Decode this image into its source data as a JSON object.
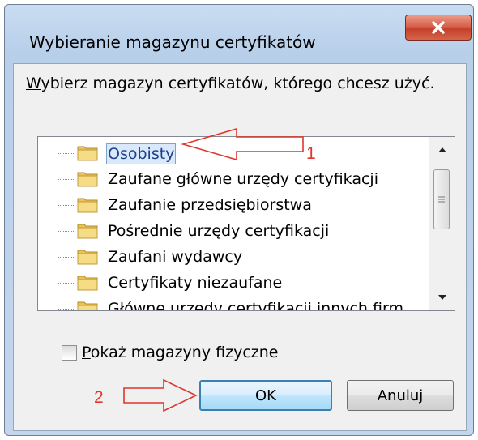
{
  "window": {
    "title": "Wybieranie magazynu certyfikatów",
    "close_glyph": "X"
  },
  "prompt": {
    "accelerator": "W",
    "rest": "ybierz magazyn certyfikatów, którego chcesz użyć."
  },
  "stores": {
    "items": [
      {
        "label": "Osobisty",
        "selected": true
      },
      {
        "label": "Zaufane główne urzędy certyfikacji",
        "selected": false
      },
      {
        "label": "Zaufanie przedsiębiorstwa",
        "selected": false
      },
      {
        "label": "Pośrednie urzędy certyfikacji",
        "selected": false
      },
      {
        "label": "Zaufani wydawcy",
        "selected": false
      },
      {
        "label": "Certyfikaty niezaufane",
        "selected": false
      },
      {
        "label": "Główne urzędy certyfikacji innych firm",
        "selected": false
      }
    ]
  },
  "show_physical": {
    "accelerator": "P",
    "rest": "okaż magazyny fizyczne",
    "checked": false
  },
  "buttons": {
    "ok": "OK",
    "cancel": "Anuluj"
  },
  "annotations": {
    "marker_1": "1",
    "marker_2": "2",
    "color": "#e0362c"
  },
  "icons": {
    "folder": "folder-icon",
    "close": "close-icon",
    "scroll_up": "chevron-up-icon",
    "scroll_down": "chevron-down-icon"
  }
}
